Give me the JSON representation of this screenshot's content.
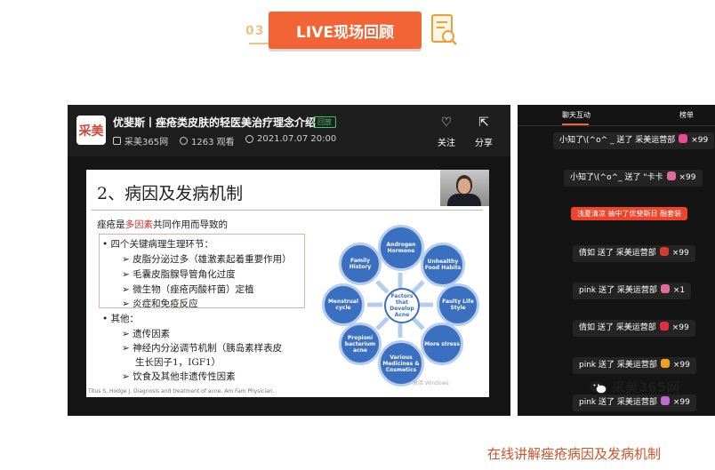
{
  "header": {
    "number": "03",
    "title": "LIVE现场回顾"
  },
  "player": {
    "logo": "采美",
    "title": "优斐斯丨痤疮类皮肤的轻医美治疗理念介绍",
    "badge": "回放",
    "channel": "采美365网",
    "views": "1263 观看",
    "datetime": "2021.07.07 20:00",
    "follow_label": "关注",
    "share_label": "分享"
  },
  "slide": {
    "title": "2、病因及发病机制",
    "intro_prefix": "痤疮是",
    "intro_red": "多因素",
    "intro_suffix": "共同作用而导致的",
    "bullet1": "•  四个关键病理生理环节：",
    "sub1": [
      "➢  皮脂分泌过多（雄激素起着重要作用）",
      "➢  毛囊皮脂腺导管角化过度",
      "➢  微生物（痤疮丙酸杆菌）定植",
      "➢  炎症和免疫反应"
    ],
    "bullet2": "•  其他：",
    "sub2": [
      "➢  遗传因素",
      "➢  神经内分泌调节机制（胰岛素样表皮",
      "生长因子1，IGF1）",
      "➢  饮食及其他非遗传性因素"
    ],
    "citation": "Titus S, Hodge J. Diagnosis and treatment of acne. Am Fam Physician.",
    "watermark": "激活 Windows",
    "diagram": {
      "center": "Factors that Develop Acne",
      "nodes": [
        "Androgen Hormone",
        "Unhealthy Food Habits",
        "Faulty Life Style",
        "More stress",
        "Various Medicines & Cosmetics",
        "Propioni bacterium acne",
        "Menstrual cycle",
        "Family History"
      ]
    }
  },
  "chat": {
    "tabs": [
      "聊天互动",
      "榜单"
    ],
    "messages": [
      {
        "text": "小知了\\(^o^ _ 送了 采美运营部",
        "count": "×99",
        "color": "#e8508c"
      },
      {
        "text": "小知了\\(^o^_ 送了 \"卡卡",
        "count": "×99",
        "color": "#e06a9a"
      },
      {
        "text": "浅夏清凉 抽中了优斐斯日 融套装",
        "count": "",
        "color": ""
      },
      {
        "text": "倩如 送了 采美运营部",
        "count": "×99",
        "color": "#d33b2c"
      },
      {
        "text": "pink 送了 采美运营部",
        "count": "×1",
        "color": "#e06a9a"
      },
      {
        "text": "倩如 送了 采美运营部",
        "count": "×99",
        "color": "#e03040"
      },
      {
        "text": "pink 送了 采美运营部",
        "count": "×99",
        "color": "#f0a020"
      },
      {
        "text": "pink 送了 采美运营部",
        "count": "×99",
        "color": "#c06ad0"
      }
    ]
  },
  "wechat": "采美365网",
  "caption": "在线讲解痤疮病因及发病机制",
  "colors": {
    "accent": "#f26436",
    "caption": "#c8552a",
    "diagram_blue": "#3b6fc0"
  }
}
